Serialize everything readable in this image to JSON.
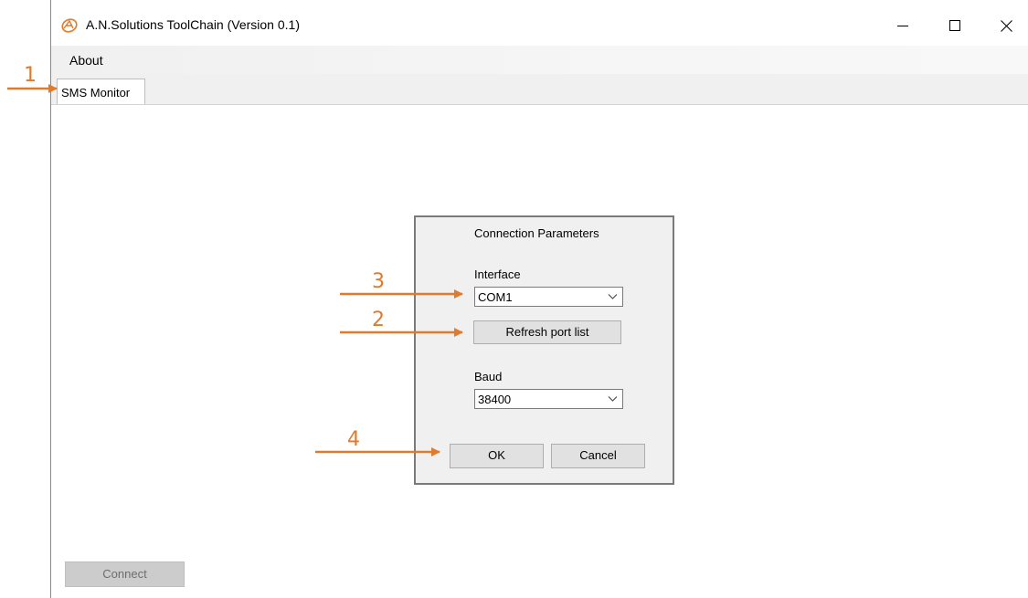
{
  "window": {
    "title": "A.N.Solutions ToolChain (Version 0.1)",
    "icon": "app-logo-icon",
    "controls": [
      "minimize-icon",
      "maximize-icon",
      "close-icon"
    ]
  },
  "menu": {
    "about_label": "About"
  },
  "tabs": [
    {
      "label": "SMS Monitor",
      "selected": true
    }
  ],
  "dialog": {
    "title": "Connection Parameters",
    "interface_label": "Interface",
    "interface_value": "COM1",
    "refresh_label": "Refresh port list",
    "baud_label": "Baud",
    "baud_value": "38400",
    "ok_label": "OK",
    "cancel_label": "Cancel"
  },
  "connect_label": "Connect",
  "annotations": {
    "color": "#e07a2c",
    "labels": [
      "1",
      "2",
      "3",
      "4"
    ]
  }
}
